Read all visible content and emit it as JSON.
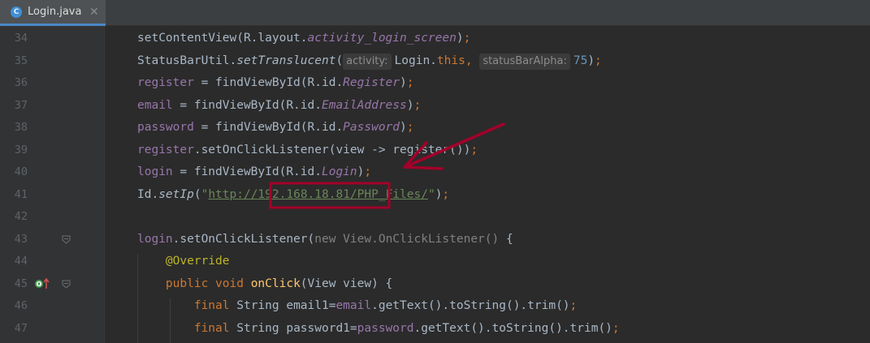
{
  "tab": {
    "title": "Login.java",
    "icon_letter": "C",
    "close_glyph": "✕"
  },
  "lines": [
    {
      "num": "34",
      "html": "setContentView(R.layout.<span class=\"it\">activity_login_screen</span>)<span class=\"k\">;</span>"
    },
    {
      "num": "35",
      "html": "StatusBarUtil.<span class=\"si\">setTranslucent</span>(<span class=\"hint\">activity:</span>Login.<span class=\"k\">this, </span><span class=\"hint\">statusBarAlpha:</span><span class=\"num\">75</span>)<span class=\"k\">;</span>"
    },
    {
      "num": "36",
      "html": "<span class=\"f\">register</span> = findViewById(R.id.<span class=\"it\">Register</span>)<span class=\"k\">;</span>"
    },
    {
      "num": "37",
      "html": "<span class=\"f\">email</span> = findViewById(R.id.<span class=\"it\">EmailAddress</span>)<span class=\"k\">;</span>"
    },
    {
      "num": "38",
      "html": "<span class=\"f\">password</span> = findViewById(R.id.<span class=\"it\">Password</span>)<span class=\"k\">;</span>"
    },
    {
      "num": "39",
      "html": "<span class=\"f\">register</span>.setOnClickListener(view -&gt; register())<span class=\"k\">;</span>"
    },
    {
      "num": "40",
      "html": "<span class=\"f\">login</span> = findViewById(R.id.<span class=\"it\">Login</span>)<span class=\"k\">;</span>"
    },
    {
      "num": "41",
      "html": "Id.<span class=\"si\">setIp</span>(<span class=\"str\">\"</span><span class=\"url\">http://192.168.18.81/PHP_Files/</span><span class=\"str\">\"</span>)<span class=\"k\">;</span>"
    },
    {
      "num": "42",
      "html": ""
    },
    {
      "num": "43",
      "html": "<span class=\"f\">login</span>.setOnClickListener(<span class=\"gr\">new View.OnClickListener() </span>{"
    },
    {
      "num": "44",
      "html": "    <span class=\"ann\">@Override</span>"
    },
    {
      "num": "45",
      "html": "    <span class=\"k\">public void </span><span class=\"fn\">onClick</span>(View view) {"
    },
    {
      "num": "46",
      "html": "        <span class=\"k\">final </span>String email1=<span class=\"f\">email</span>.getText().toString().trim()<span class=\"k\">;</span>"
    },
    {
      "num": "47",
      "html": "        <span class=\"k\">final </span>String password1=<span class=\"f\">password</span>.getText().toString().trim()<span class=\"k\">;</span>"
    }
  ],
  "highlight_note": "192.168.18.81",
  "colors": {
    "annotation": "#a3002a",
    "keyword": "#cc7832",
    "field": "#9876aa",
    "string": "#6a8759"
  }
}
